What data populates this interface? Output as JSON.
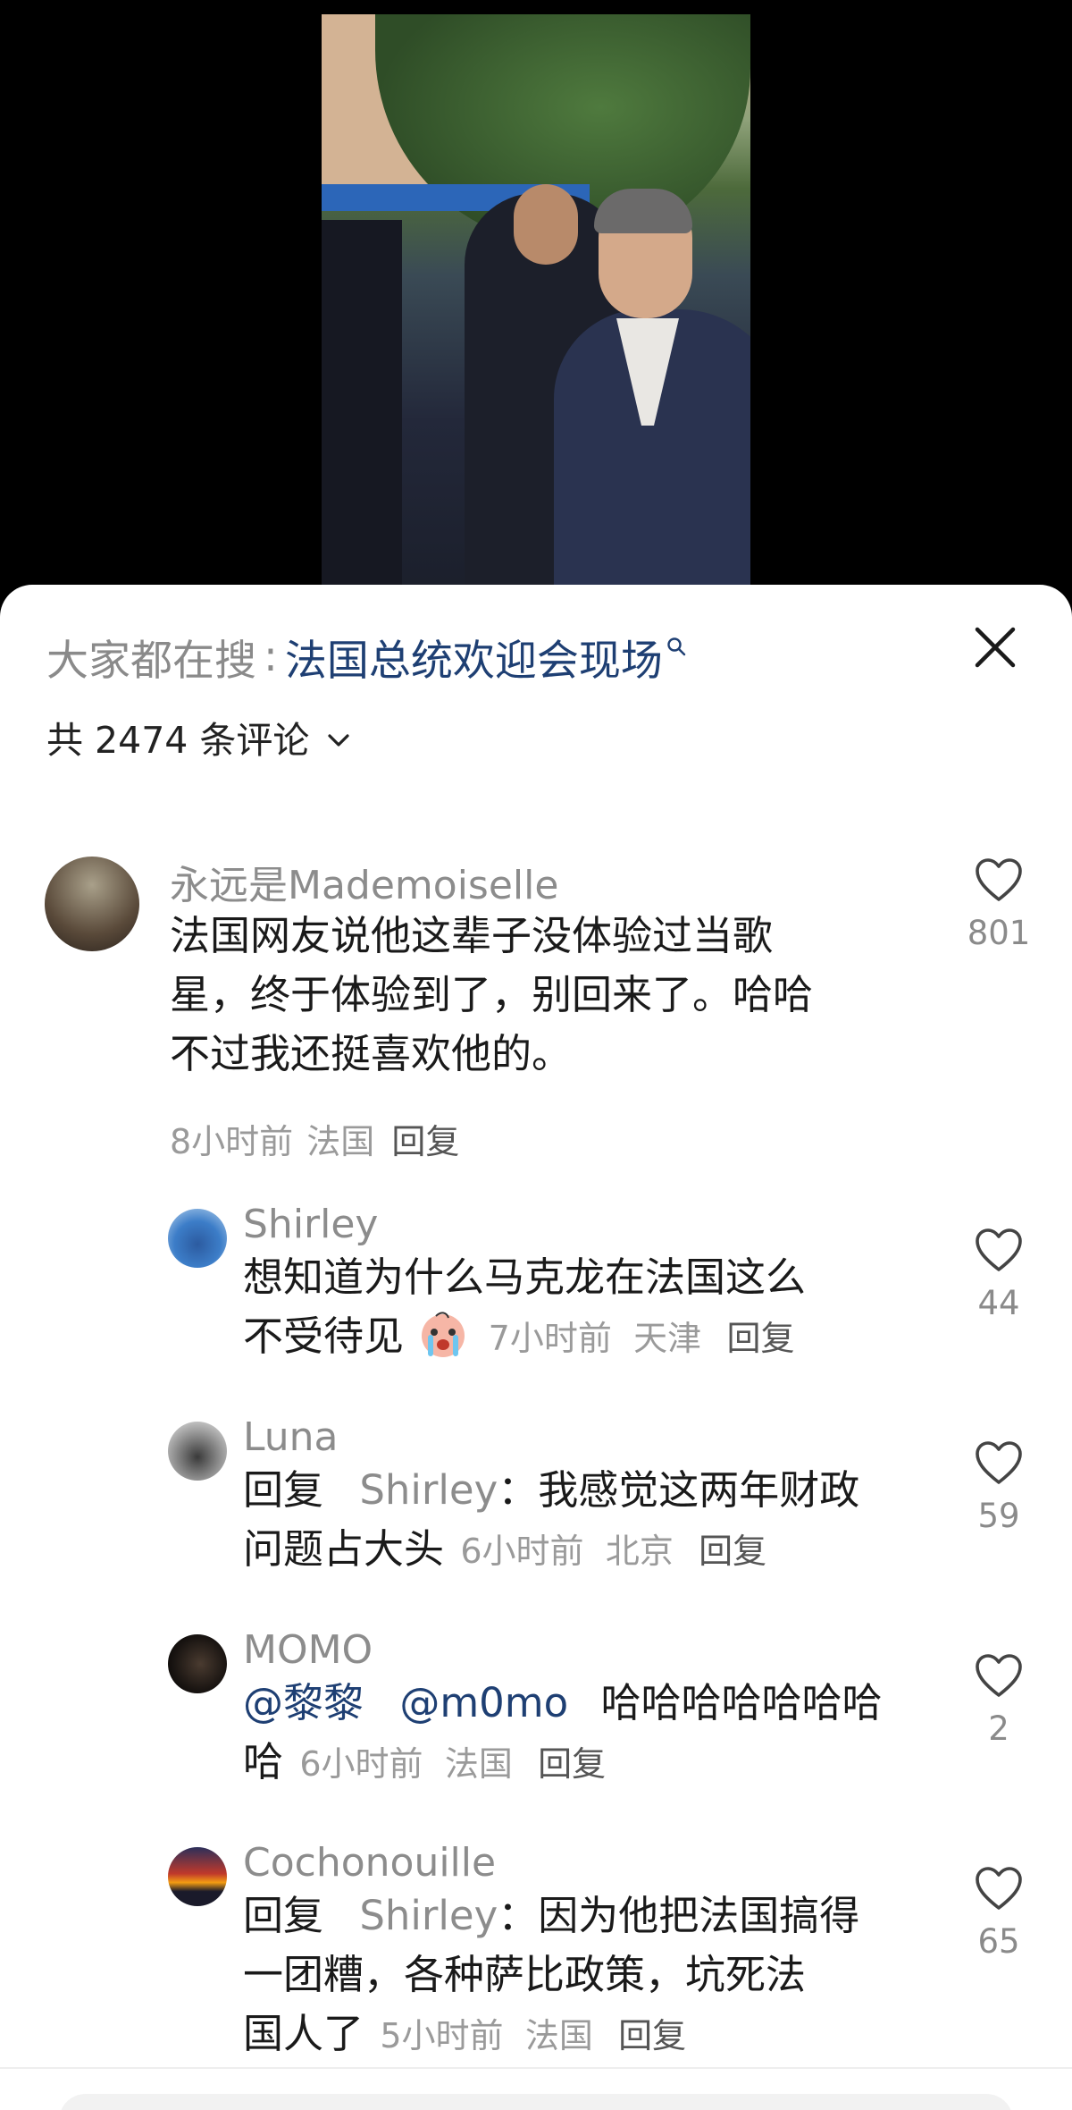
{
  "search": {
    "prefix": "大家都在搜",
    "colon": ":",
    "term": "法国总统欢迎会现场"
  },
  "count_label": "共 2474 条评论",
  "comments": [
    {
      "user": "永远是Mademoiselle",
      "lines": [
        "法国网友说他这辈子没体验过当歌",
        "星，终于体验到了，别回来了。哈哈",
        "不过我还挺喜欢他的。"
      ],
      "time": "8小时前",
      "location": "法国",
      "reply": "回复",
      "likes": "801"
    },
    {
      "user": "Shirley",
      "line1": "想知道为什么马克龙在法国这么",
      "line2": "不受待见",
      "time": "7小时前",
      "location": "天津",
      "reply": "回复",
      "likes": "44"
    },
    {
      "user": "Luna",
      "reply_prefix": "回复",
      "reply_to": "Shirley",
      "reply_colon": "：",
      "line1": "我感觉这两年财政",
      "line2": "问题占大头",
      "time": "6小时前",
      "location": "北京",
      "reply": "回复",
      "likes": "59"
    },
    {
      "user": "MOMO",
      "mention1": "@黎黎",
      "mention2": "@m0mo",
      "line1": "哈哈哈哈哈哈哈",
      "line2": "哈",
      "time": "6小时前",
      "location": "法国",
      "reply": "回复",
      "likes": "2"
    },
    {
      "user": "Cochonouille",
      "reply_prefix": "回复",
      "reply_to": "Shirley",
      "reply_colon": "：",
      "line1": "因为他把法国搞得",
      "line2": "一团糟，各种萨比政策，坑死法",
      "line3": "国人了",
      "time": "5小时前",
      "location": "法国",
      "reply": "回复",
      "likes": "65"
    }
  ],
  "icons": {
    "close": "close-icon",
    "like": "heart-outline-icon",
    "search_hint": "search-icon",
    "expand": "chevron-down-icon",
    "emoji": "crying-emoji-icon"
  },
  "colors": {
    "accent": "#1e3f73",
    "muted": "#8c8c8c"
  }
}
